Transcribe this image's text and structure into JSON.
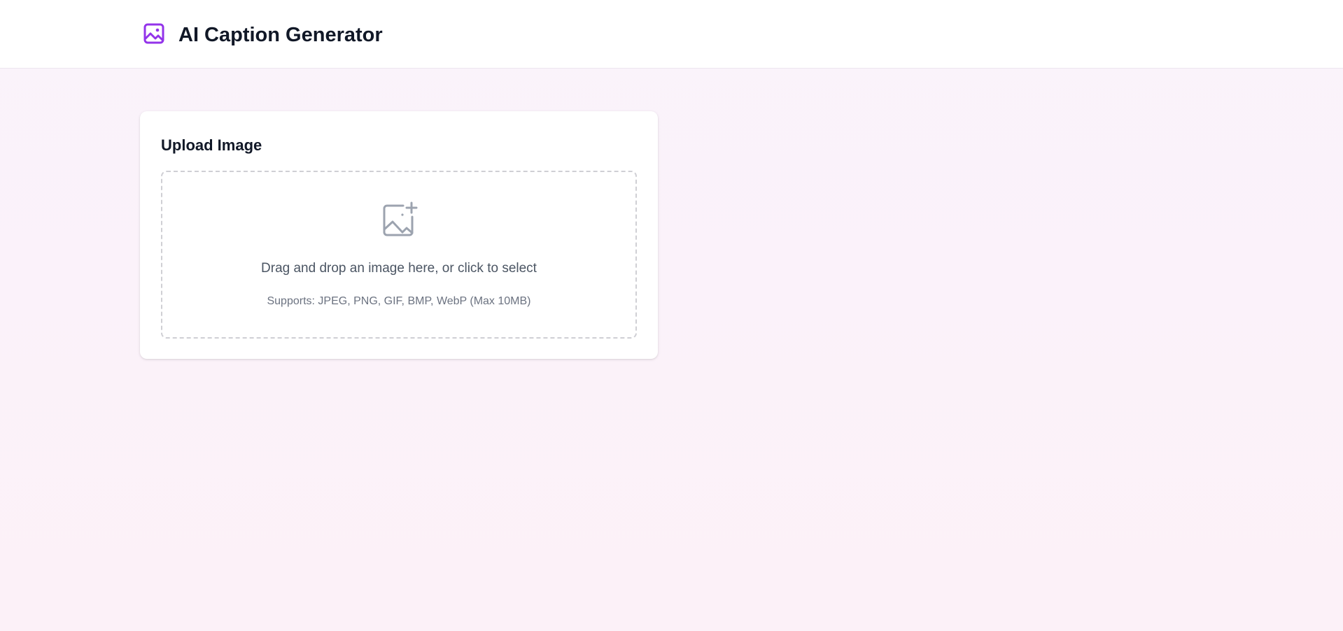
{
  "header": {
    "title": "AI Caption Generator",
    "logo_icon": "image-icon",
    "accent_color": "#9333ea"
  },
  "upload_card": {
    "title": "Upload Image",
    "dropzone": {
      "icon": "image-plus-icon",
      "instruction": "Drag and drop an image here, or click to select",
      "supports": "Supports: JPEG, PNG, GIF, BMP, WebP (Max 10MB)"
    }
  },
  "colors": {
    "background": "#faf3fb",
    "card": "#ffffff",
    "title_text": "#111827",
    "muted_text": "#6b7280",
    "icon_gray": "#9ca3af"
  }
}
